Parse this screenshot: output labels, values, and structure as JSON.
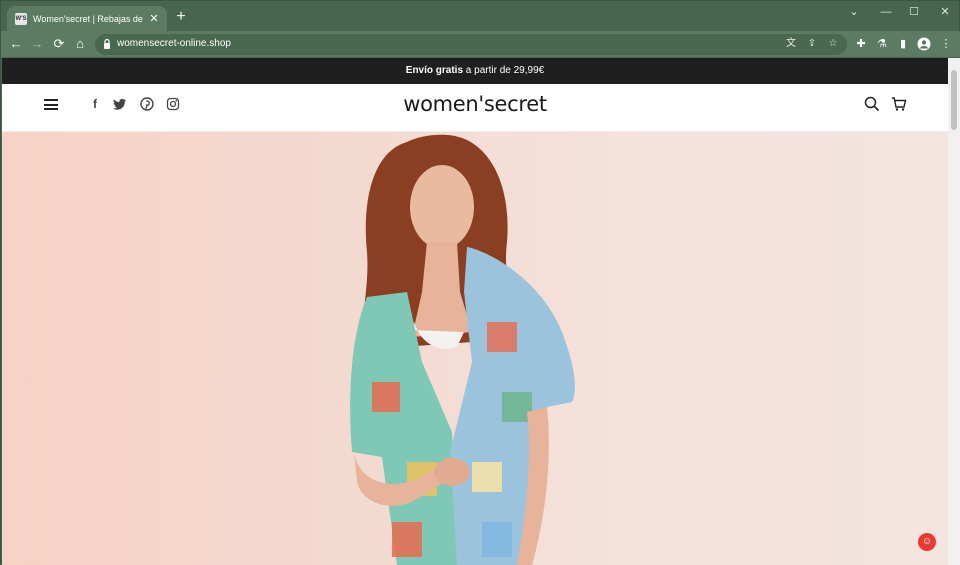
{
  "browser": {
    "tab_title": "Women'secret | Rebajas de verano",
    "favicon_text": "W'S",
    "new_tab": "+",
    "tab_close": "✕",
    "url": "womensecret-online.shop",
    "controls": {
      "minimize": "—",
      "maximize": "☐",
      "close": "✕",
      "tab_search": "⌄"
    }
  },
  "promo": {
    "bold": "Envío gratis",
    "rest": " a partir de 29,99€"
  },
  "header": {
    "logo": "women'secret"
  },
  "colors": {
    "titlebar": "#47654f",
    "toolbar": "#5b7b63",
    "promo_bg": "#1f1f1f",
    "hero_bg": "#f5dcd2",
    "chat_button": "#e63a33"
  }
}
